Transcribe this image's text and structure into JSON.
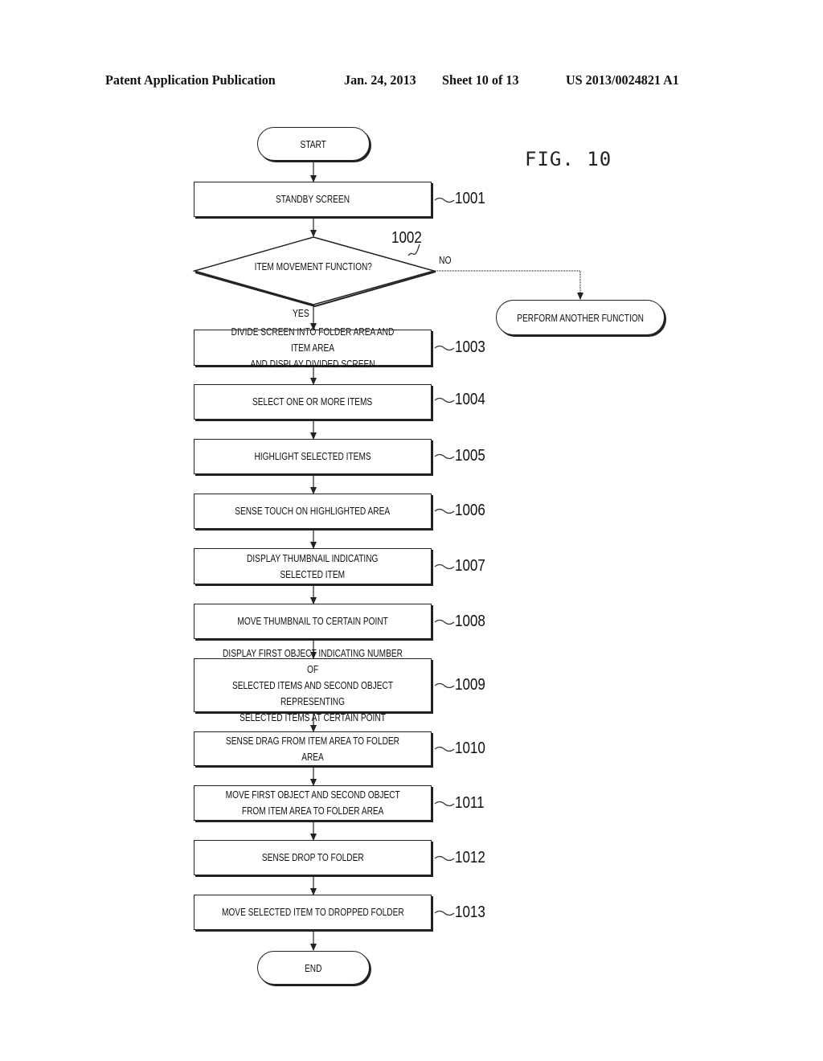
{
  "header": {
    "publication": "Patent Application Publication",
    "date": "Jan. 24, 2013",
    "sheet": "Sheet 10 of 13",
    "number": "US 2013/0024821 A1"
  },
  "figure_label": "FIG. 10",
  "flowchart": {
    "start": "START",
    "end": "END",
    "decision": {
      "ref": "1002",
      "text": "ITEM MOVEMENT FUNCTION?",
      "yes_label": "YES",
      "no_label": "NO",
      "no_target": "PERFORM ANOTHER FUNCTION"
    },
    "steps": [
      {
        "ref": "1001",
        "text": "STANDBY SCREEN"
      },
      {
        "ref": "1003",
        "text": "DIVIDE SCREEN INTO FOLDER AREA AND ITEM AREA\nAND DISPLAY DIVIDED SCREEN"
      },
      {
        "ref": "1004",
        "text": "SELECT ONE OR MORE ITEMS"
      },
      {
        "ref": "1005",
        "text": "HIGHLIGHT SELECTED ITEMS"
      },
      {
        "ref": "1006",
        "text": "SENSE TOUCH ON HIGHLIGHTED AREA"
      },
      {
        "ref": "1007",
        "text": "DISPLAY THUMBNAIL INDICATING\nSELECTED ITEM"
      },
      {
        "ref": "1008",
        "text": "MOVE THUMBNAIL TO CERTAIN POINT"
      },
      {
        "ref": "1009",
        "text": "DISPLAY FIRST OBJECT INDICATING NUMBER OF\nSELECTED ITEMS AND SECOND OBJECT REPRESENTING\nSELECTED ITEMS AT CERTAIN POINT"
      },
      {
        "ref": "1010",
        "text": "SENSE DRAG FROM ITEM AREA TO FOLDER AREA"
      },
      {
        "ref": "1011",
        "text": "MOVE FIRST OBJECT AND SECOND OBJECT\nFROM ITEM AREA TO FOLDER AREA"
      },
      {
        "ref": "1012",
        "text": "SENSE DROP TO FOLDER"
      },
      {
        "ref": "1013",
        "text": "MOVE SELECTED ITEM TO DROPPED FOLDER"
      }
    ]
  }
}
